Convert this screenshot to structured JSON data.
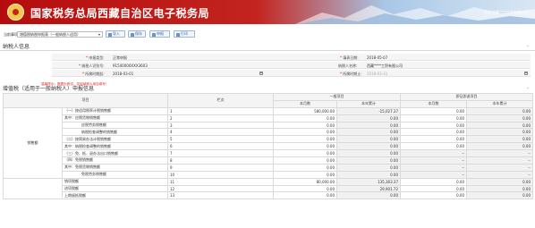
{
  "header": {
    "title": "国家税务总局西藏自治区电子税务局",
    "user_info": "欢迎 西藏****工贸有限公司"
  },
  "toolbar": {
    "label": "当前事项:",
    "select_value": "增值税纳税申报表（一般纳税人适用）",
    "buttons": [
      {
        "label": "导入"
      },
      {
        "label": "保存"
      },
      {
        "label": "申报"
      },
      {
        "label": "打印"
      }
    ]
  },
  "taxpayer_section": {
    "title": "纳税人信息",
    "rows": [
      {
        "left_label": "申报类型",
        "left_value": "正常申报",
        "right_label": "填表日期",
        "right_value": "2018-05-07"
      },
      {
        "left_label": "纳税人识别号",
        "left_value": "91540000XXX3603",
        "right_label": "纳税人名称",
        "right_value": "西藏****工贸有限公司"
      },
      {
        "left_label": "所属时期起",
        "left_value": "2018-03-01",
        "right_label": "所属时期止",
        "right_value": "2018-03-31"
      }
    ],
    "warning": "温馨提示：数据为测试，仅用纳税人用自填写！"
  },
  "table_section": {
    "title": "增值税（适用于一般纳税人）申报信息",
    "headers": {
      "item": "项目",
      "line": "栏次",
      "general": "一般项目",
      "immediate": "即征即退项目",
      "current_month": "本月数",
      "year_total": "本年累计"
    },
    "category": "销售额",
    "rows": [
      {
        "item": "（一）按适用税率计税销售额",
        "line": "1",
        "v1": "580,000.00",
        "v2": "-15,027.37",
        "v3": "0.00",
        "v4": "0.00"
      },
      {
        "item": "其中：应税货物销售额",
        "line": "2",
        "v1": "0.00",
        "v2": "0.00",
        "v3": "0.00",
        "v4": "0.00"
      },
      {
        "item": "应税劳务销售额",
        "line": "3",
        "v1": "0.00",
        "v2": "0.00",
        "v3": "0.00",
        "v4": "0.00"
      },
      {
        "item": "纳税检查调整的销售额",
        "line": "4",
        "v1": "0.00",
        "v2": "0.00",
        "v3": "0.00",
        "v4": "0.00"
      },
      {
        "item": "（二）按简易办法计税销售额",
        "line": "5",
        "v1": "0.00",
        "v2": "0.00",
        "v3": "0.00",
        "v4": "0.00"
      },
      {
        "item": "其中：纳税检查调整的销售额",
        "line": "6",
        "v1": "0.00",
        "v2": "0.00",
        "v3": "0.00",
        "v4": "0.00"
      },
      {
        "item": "（三）免、抵、退办法出口销售额",
        "line": "7",
        "v1": "0.00",
        "v2": "0.00",
        "v3": "--",
        "v4": "--"
      },
      {
        "item": "（四）免税销售额",
        "line": "8",
        "v1": "0.00",
        "v2": "0.00",
        "v3": "--",
        "v4": "--"
      },
      {
        "item": "其中：免税货物销售额",
        "line": "9",
        "v1": "0.00",
        "v2": "0.00",
        "v3": "--",
        "v4": "--"
      },
      {
        "item": "免税劳务销售额",
        "line": "10",
        "v1": "0.00",
        "v2": "0.00",
        "v3": "--",
        "v4": "--"
      },
      {
        "item": "销项税额",
        "line": "11",
        "v1": "80,000.00",
        "v2": "135,363.37",
        "v3": "0.00",
        "v4": "0.00"
      },
      {
        "item": "进项税额",
        "line": "12",
        "v1": "0.00",
        "v2": "29,901.72",
        "v3": "0.00",
        "v4": "0.00"
      },
      {
        "item": "上期留抵税额",
        "line": "13",
        "v1": "0.00",
        "v2": "0.00",
        "v3": "0.00",
        "v4": "0.00"
      }
    ]
  },
  "colors": {
    "header_red": "#c3241f",
    "accent_blue": "#2d5d9b",
    "warning_red": "#e02020"
  }
}
